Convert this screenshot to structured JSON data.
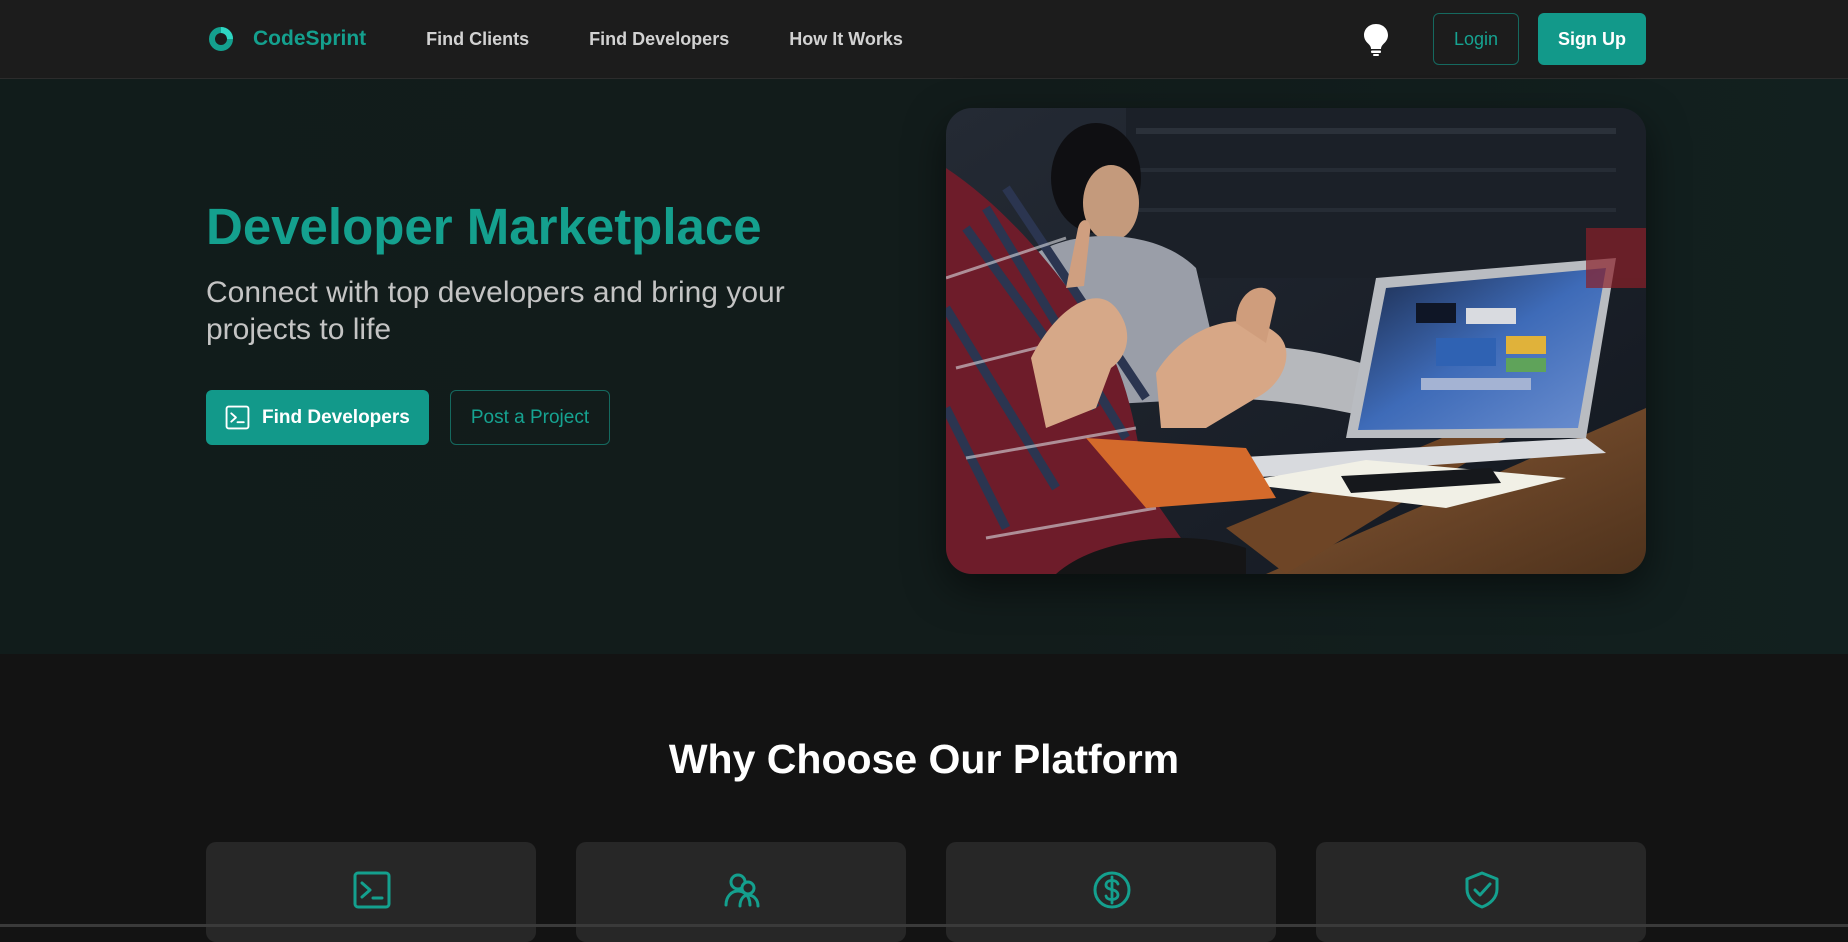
{
  "brand": {
    "name": "CodeSprint",
    "logo_icon": "brand-logo-icon",
    "accent_color": "#14a08e"
  },
  "nav": {
    "links": [
      "Find Clients",
      "Find Developers",
      "How It Works"
    ],
    "theme_toggle_icon": "lightbulb-icon",
    "login_label": "Login",
    "signup_label": "Sign Up"
  },
  "hero": {
    "title": "Developer Marketplace",
    "subtitle": "Connect with top developers and bring your projects to life",
    "primary_cta": "Find Developers",
    "primary_cta_icon": "terminal-icon",
    "secondary_cta": "Post a Project",
    "image": "team-meeting-laptop-photo"
  },
  "features": {
    "title": "Why Choose Our Platform",
    "cards": [
      {
        "icon": "terminal-icon"
      },
      {
        "icon": "users-icon"
      },
      {
        "icon": "dollar-circle-icon"
      },
      {
        "icon": "shield-check-icon"
      }
    ]
  },
  "colors": {
    "primary": "#12998a",
    "nav_background": "#1c1c1c",
    "hero_background": "#121c1b",
    "page_background": "#131313",
    "card_background": "#272727"
  }
}
